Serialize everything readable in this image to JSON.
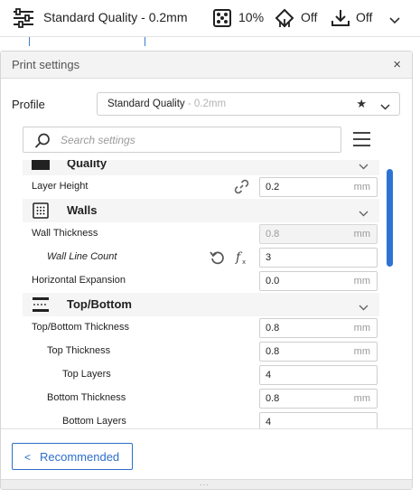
{
  "toolbar": {
    "profile_name": "Standard Quality - 0.2mm",
    "infill_value": "10%",
    "support_value": "Off",
    "adhesion_value": "Off"
  },
  "panel": {
    "title": "Print settings",
    "close_symbol": "×",
    "profile_label": "Profile",
    "profile_name": "Standard Quality",
    "profile_sub": " - 0.2mm",
    "star_symbol": "★",
    "search_placeholder": "Search settings",
    "recommended_chevron": "<",
    "recommended_label": "Recommended",
    "grip_symbol": "···"
  },
  "categories": {
    "quality": "Quality",
    "walls": "Walls",
    "top_bottom": "Top/Bottom"
  },
  "settings": {
    "layer_height": {
      "label": "Layer Height",
      "value": "0.2",
      "unit": "mm"
    },
    "wall_thickness": {
      "label": "Wall Thickness",
      "value": "0.8",
      "unit": "mm"
    },
    "wall_line_count": {
      "label": "Wall Line Count",
      "value": "3"
    },
    "horizontal_expansion": {
      "label": "Horizontal Expansion",
      "value": "0.0",
      "unit": "mm"
    },
    "top_bottom_thickness": {
      "label": "Top/Bottom Thickness",
      "value": "0.8",
      "unit": "mm"
    },
    "top_thickness": {
      "label": "Top Thickness",
      "value": "0.8",
      "unit": "mm"
    },
    "top_layers": {
      "label": "Top Layers",
      "value": "4"
    },
    "bottom_thickness": {
      "label": "Bottom Thickness",
      "value": "0.8",
      "unit": "mm"
    },
    "bottom_layers": {
      "label": "Bottom Layers",
      "value": "4"
    }
  },
  "icons": {
    "toolbar": [
      "settings-sliders-icon",
      "infill-icon",
      "support-icon",
      "adhesion-icon",
      "chevron-down-icon"
    ],
    "rows": [
      "link-icon",
      "reset-icon",
      "function-icon"
    ],
    "other": [
      "search-icon",
      "menu-icon",
      "star-icon",
      "close-icon"
    ]
  },
  "colors": {
    "accent": "#2d6fcc",
    "scrollbar": "#2e73d4",
    "text": "#1f1f1f",
    "muted": "#9a9a9a"
  }
}
